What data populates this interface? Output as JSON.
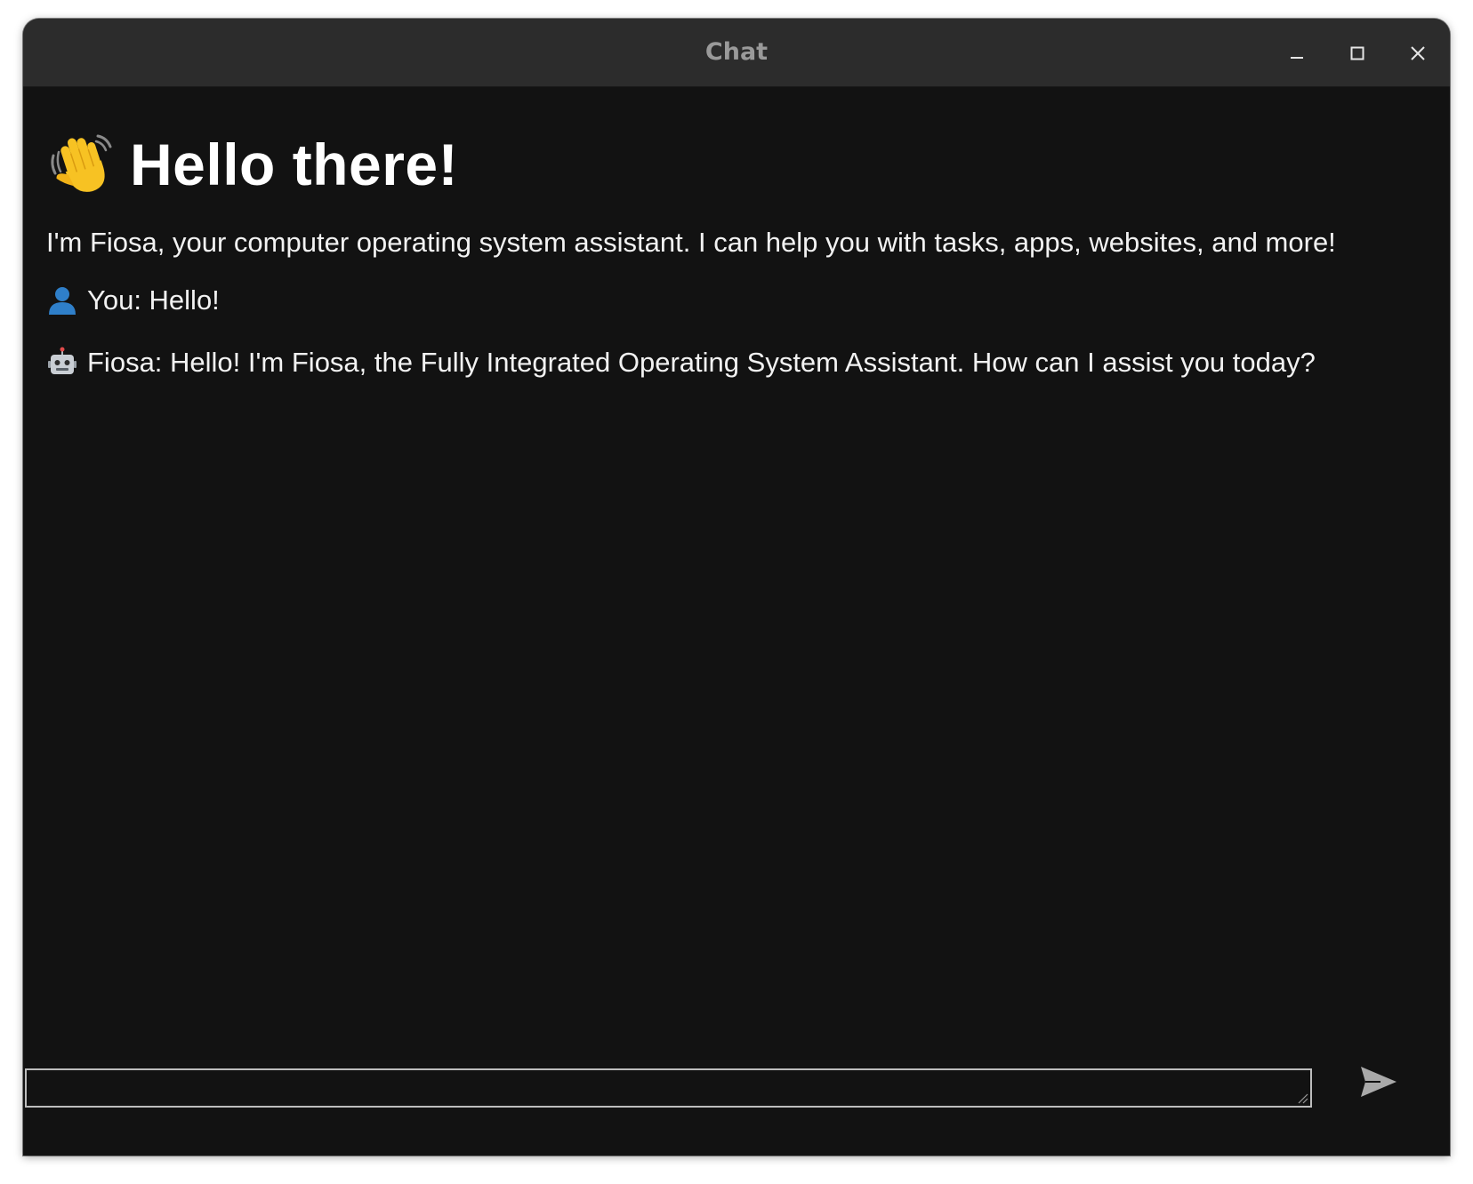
{
  "window": {
    "title": "Chat",
    "controls": [
      "minimize-icon",
      "maximize-icon",
      "close-icon"
    ]
  },
  "chat": {
    "greeting_icon": "waving-hand-icon",
    "greeting": "Hello there!",
    "intro": "I'm Fiosa, your computer operating system assistant. I can help you with tasks, apps, websites, and more!",
    "messages": [
      {
        "icon": "user-icon",
        "text": "You: Hello!"
      },
      {
        "icon": "robot-icon",
        "text": "Fiosa: Hello! I'm Fiosa, the Fully Integrated Operating System Assistant. How can I assist you today?"
      }
    ]
  },
  "composer": {
    "value": "",
    "send_icon": "send-icon"
  },
  "colors": {
    "background": "#121212",
    "titlebar": "#2c2c2c",
    "text": "#f2f2f2",
    "user_icon": "#2f7fc9",
    "send_icon": "#a9a9a9"
  }
}
